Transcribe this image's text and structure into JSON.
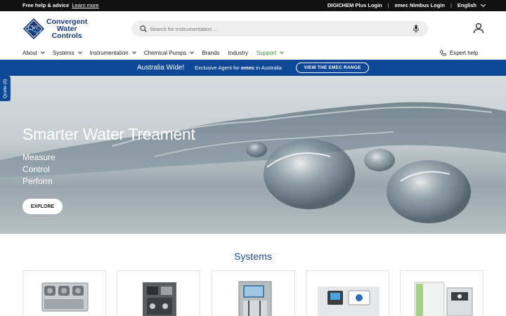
{
  "topbar": {
    "promo_bold": "Free help & advice",
    "promo_link": "Learn more",
    "links": [
      "DIGICHEM Plus Login",
      "emec Nimbus Login",
      "English"
    ]
  },
  "header": {
    "logo_lines": [
      "Convergent",
      "Water",
      "Controls"
    ],
    "logo_mark": "CWC",
    "search_placeholder": "Search for Instrumentation ...",
    "account_icon": "user-icon"
  },
  "nav": {
    "items": [
      "About",
      "Systems",
      "Instrumentation",
      "Chemical Pumps",
      "Brands",
      "Industry",
      "Support"
    ],
    "expert_help": "Expert help"
  },
  "banner": {
    "region": "Australia Wide!",
    "agent_prefix": "Exclusive Agent for",
    "agent_brand": "emec",
    "agent_suffix": "in Australia",
    "button": "VIEW THE EMEC RANGE"
  },
  "quote_tab": "Quote (0)",
  "hero": {
    "title": "Smarter Water Treament",
    "lines": [
      "Measure",
      "Control",
      "Perform"
    ],
    "button": "EXPLORE"
  },
  "systems": {
    "title": "Systems",
    "card_count": 5
  },
  "colors": {
    "brand_blue": "#0e4896",
    "support_green": "#3b8a3a",
    "title_blue": "#1f4f8f"
  }
}
